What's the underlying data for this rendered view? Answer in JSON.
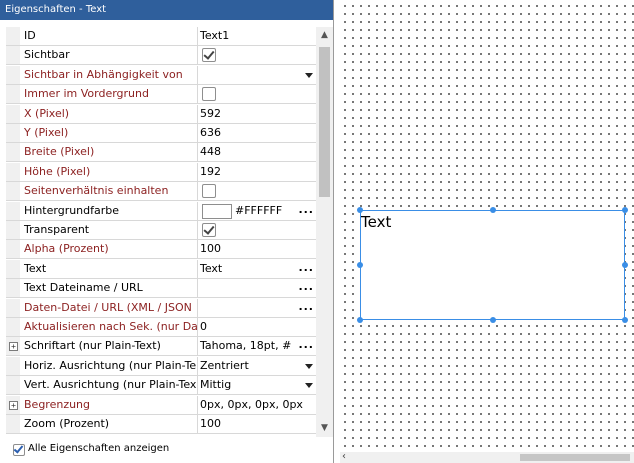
{
  "panel": {
    "title": "Eigenschaften - Text",
    "show_all_label": "Alle Eigenschaften anzeigen",
    "show_all_checked": true
  },
  "properties": [
    {
      "name": "ID",
      "value": "Text1",
      "type": "text",
      "required": false
    },
    {
      "name": "Sichtbar",
      "value": "",
      "type": "checkbox",
      "checked": true,
      "required": false
    },
    {
      "name": "Sichtbar in Abhängigkeit von",
      "value": "",
      "type": "dropdown",
      "required": true
    },
    {
      "name": "Immer im Vordergrund",
      "value": "",
      "type": "checkbox",
      "checked": false,
      "required": true
    },
    {
      "name": "X (Pixel)",
      "value": "592",
      "type": "text",
      "required": true
    },
    {
      "name": "Y (Pixel)",
      "value": "636",
      "type": "text",
      "required": true
    },
    {
      "name": "Breite (Pixel)",
      "value": "448",
      "type": "text",
      "required": true
    },
    {
      "name": "Höhe (Pixel)",
      "value": "192",
      "type": "text",
      "required": true
    },
    {
      "name": "Seitenverhältnis einhalten",
      "value": "",
      "type": "checkbox",
      "checked": false,
      "required": true
    },
    {
      "name": "Hintergrundfarbe",
      "value": "#FFFFFF",
      "type": "color",
      "required": false
    },
    {
      "name": "Transparent",
      "value": "",
      "type": "checkbox",
      "checked": true,
      "required": false
    },
    {
      "name": "Alpha (Prozent)",
      "value": "100",
      "type": "text",
      "required": true
    },
    {
      "name": "Text",
      "value": "Text",
      "type": "ellipsis",
      "required": false
    },
    {
      "name": "Text Dateiname / URL",
      "value": "",
      "type": "ellipsis",
      "required": false
    },
    {
      "name": "Daten-Datei / URL (XML / JSON",
      "value": "",
      "type": "ellipsis",
      "required": true
    },
    {
      "name": "Aktualisieren nach Sek. (nur Da",
      "value": "0",
      "type": "text",
      "required": true
    },
    {
      "name": "Schriftart (nur Plain-Text)",
      "value": "Tahoma, 18pt, #",
      "type": "ellipsis",
      "expandable": true,
      "required": false
    },
    {
      "name": "Horiz. Ausrichtung (nur Plain-Te",
      "value": "Zentriert",
      "type": "dropdown",
      "required": false
    },
    {
      "name": "Vert. Ausrichtung (nur Plain-Tex",
      "value": "Mittig",
      "type": "dropdown",
      "required": false
    },
    {
      "name": "Begrenzung",
      "value": "0px, 0px, 0px, 0px",
      "type": "text",
      "expandable": true,
      "required": true
    },
    {
      "name": "Zoom (Prozent)",
      "value": "100",
      "type": "text",
      "required": false
    }
  ],
  "canvas": {
    "element_text": "Text",
    "selection_color": "#3a8ee6"
  },
  "colors": {
    "title_bg": "#2f5f9c",
    "required_label": "#8b1f1f"
  }
}
